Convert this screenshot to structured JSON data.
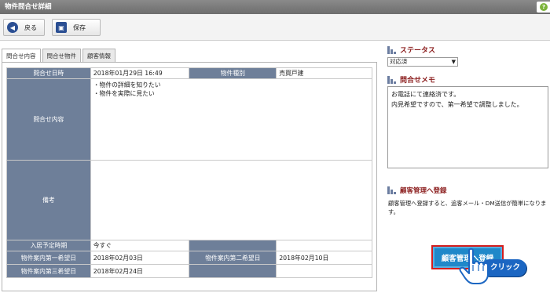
{
  "window": {
    "title": "物件問合せ詳細",
    "help_label": "?"
  },
  "toolbar": {
    "back_label": "戻る",
    "save_label": "保存"
  },
  "tabs": [
    {
      "label": "問合せ内容",
      "active": true
    },
    {
      "label": "問合せ物件",
      "active": false
    },
    {
      "label": "顧客情報",
      "active": false
    }
  ],
  "inquiry": {
    "date_label": "問合せ日時",
    "date_value": "2018年01月29日 16:49",
    "type_label": "物件種別",
    "type_value": "売買戸建",
    "content_label": "問合せ内容",
    "content_lines": [
      "・物件の詳細を知りたい",
      "・物件を実際に見たい"
    ],
    "remarks_label": "備考",
    "remarks_value": "",
    "move_in_label": "入居予定時期",
    "move_in_value": "今すぐ",
    "visit1_label": "物件案内第一希望日",
    "visit1_value": "2018年02月03日",
    "visit2_label": "物件案内第二希望日",
    "visit2_value": "2018年02月10日",
    "visit3_label": "物件案内第三希望日",
    "visit3_value": "2018年02月24日"
  },
  "status": {
    "heading": "ステータス",
    "selected": "対応済"
  },
  "memo": {
    "heading": "問合せメモ",
    "text": "お電話にて連絡済です。\n内見希望ですので、第一希望で調整しました。"
  },
  "customer_reg": {
    "heading": "顧客管理へ登録",
    "description": "顧客管理へ登録すると、追客メール・DM送信が簡単になります。",
    "button_label": "顧客管理へ登録"
  },
  "annotation": {
    "click_label": "クリック"
  },
  "colors": {
    "label_cell": "#6e7f99",
    "button": "#1f88c9",
    "heading": "#8b1d1d",
    "click_badge": "#1b66c2"
  }
}
